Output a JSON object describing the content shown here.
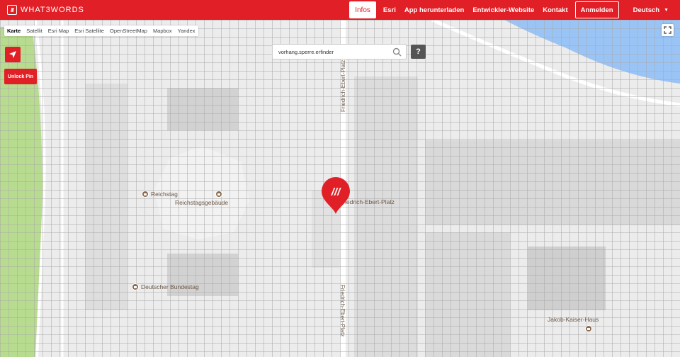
{
  "header": {
    "logo_mark": "///",
    "logo_text": "WHAT3WORDS",
    "nav": {
      "infos": "Infos",
      "esri": "Esri",
      "app": "App herunterladen",
      "dev": "Entwickler-Website",
      "contact": "Kontakt",
      "login": "Anmelden",
      "language": "Deutsch"
    },
    "brand_color": "#e11f26"
  },
  "map_types": [
    "Karte",
    "Satellit",
    "Esri Map",
    "Esri Satellite",
    "OpenStreetMap",
    "Mapbox",
    "Yandex"
  ],
  "active_map_type": "Karte",
  "controls": {
    "unlock_pin": "Unlock Pin",
    "help": "?"
  },
  "search": {
    "value": "vorhang.sperre.erfinder"
  },
  "map_labels": {
    "reichstag": "Reichstag",
    "reichstagsgebaeude": "Reichstagsgebäude",
    "bundestag": "Deutscher Bundestag",
    "jakob_kaiser": "Jakob-Kaiser-Haus",
    "street_vertical_top": "Friedrich-Ebert-Platz",
    "street_vertical_bottom": "Friedrich-Ebert-Platz",
    "square": "Friedrich-Ebert-Platz"
  },
  "pin_mark": "///"
}
